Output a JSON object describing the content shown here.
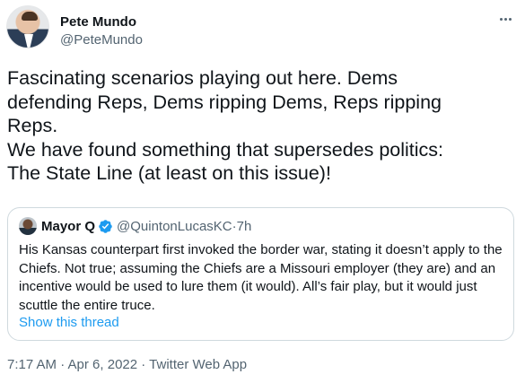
{
  "author": {
    "name": "Pete Mundo",
    "handle": "@PeteMundo"
  },
  "tweet": {
    "text": "Fascinating scenarios playing out here. Dems\ndefending Reps, Dems ripping Dems, Reps ripping\nReps.\nWe have found something that supersedes politics:\nThe State Line (at least on this issue)!"
  },
  "quoted_tweet": {
    "name": "Mayor Q",
    "handle": "@QuintonLucasKC",
    "separator": " · ",
    "time": "7h",
    "text": "His Kansas counterpart first invoked the border war, stating it doesn’t apply to the Chiefs. Not true; assuming the Chiefs are a Missouri employer (they are) and an incentive would be used to lure them (it would). All’s fair play, but it would just scuttle the entire truce.",
    "show_thread": "Show this thread"
  },
  "meta": {
    "text": "7:17 AM · Apr 6, 2022 · Twitter Web App"
  },
  "colors": {
    "accent": "#1d9bf0",
    "secondary_text": "#536471",
    "border": "#cfd9de"
  },
  "icons": [
    "more-icon",
    "verified-icon"
  ]
}
